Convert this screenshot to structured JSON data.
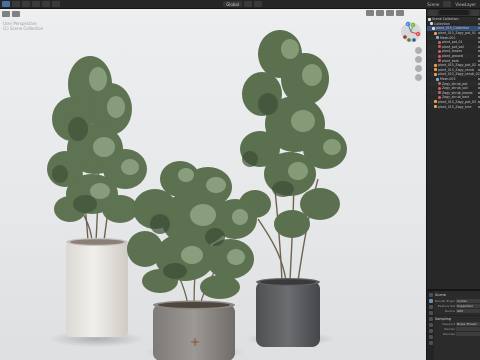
{
  "topbar": {
    "scene_label": "Scene",
    "layer_label": "ViewLayer"
  },
  "viewport": {
    "header_pill": "Global",
    "info_lines": [
      "User Perspective",
      "(1) Scene Collection"
    ],
    "gizmo_axes": {
      "x": "X",
      "y": "Y",
      "z": "Z"
    },
    "axis_colors": {
      "x": "#e5484d",
      "y": "#79b83b",
      "z": "#3d7be0"
    }
  },
  "outliner": {
    "rows": [
      {
        "label": "Scene Collection",
        "icon": "collection-icon",
        "selected": false
      },
      {
        "label": "Collection",
        "icon": "collection-icon",
        "selected": false
      },
      {
        "label": "plant_015_Collection",
        "icon": "collection-icon",
        "selected": true
      },
      {
        "label": "plant_015_Zagy_pot_01",
        "icon": "object-icon",
        "selected": false
      },
      {
        "label": "Mesh.001",
        "icon": "mesh-icon",
        "selected": false
      },
      {
        "label": "plant_pot_01",
        "icon": "material-icon",
        "selected": false
      },
      {
        "label": "plant_pot_soil",
        "icon": "material-icon",
        "selected": false
      },
      {
        "label": "plant_leaves",
        "icon": "material-icon",
        "selected": false
      },
      {
        "label": "plant_ground",
        "icon": "material-icon",
        "selected": false
      },
      {
        "label": "plant_bark",
        "icon": "material-icon",
        "selected": false
      },
      {
        "label": "plant_015_Zagy_pot_02",
        "icon": "object-icon",
        "selected": false
      },
      {
        "label": "plant_015_Zagy_shrub",
        "icon": "object-icon",
        "selected": false
      },
      {
        "label": "plant_015_Zagy_shrub_02",
        "icon": "object-icon",
        "selected": false
      },
      {
        "label": "Mesh.003",
        "icon": "mesh-icon",
        "selected": false
      },
      {
        "label": "Zagy_shrub_pot",
        "icon": "material-icon",
        "selected": false
      },
      {
        "label": "Zagy_shrub_soil",
        "icon": "material-icon",
        "selected": false
      },
      {
        "label": "Zagy_shrub_leaves",
        "icon": "material-icon",
        "selected": false
      },
      {
        "label": "Zagy_shrub_bark",
        "icon": "material-icon",
        "selected": false
      },
      {
        "label": "plant_015_Zagy_pot_03",
        "icon": "object-icon",
        "selected": false
      },
      {
        "label": "plant_015_Zagy_tree",
        "icon": "object-icon",
        "selected": false
      }
    ]
  },
  "properties": {
    "title": "Scene",
    "rows": [
      {
        "label": "Render Engine",
        "value": "Cycles"
      },
      {
        "label": "Feature Set",
        "value": "Supported"
      },
      {
        "label": "Device",
        "value": "GPU"
      }
    ],
    "section": "Sampling",
    "rows2": [
      {
        "label": "Viewport",
        "value": "Noise Thresh"
      },
      {
        "label": "Render",
        "value": ""
      },
      {
        "label": "Denoise",
        "value": ""
      }
    ]
  }
}
